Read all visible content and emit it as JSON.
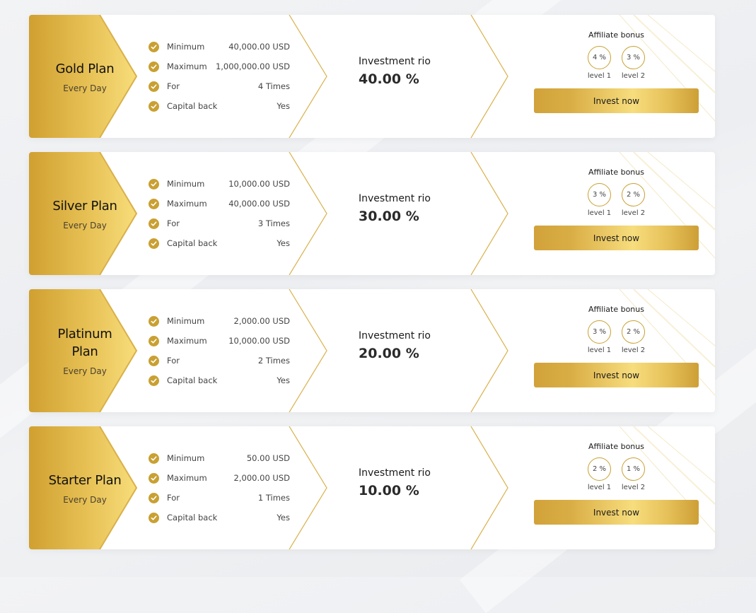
{
  "plans": [
    {
      "name": "Gold Plan",
      "period": "Every Day",
      "features": [
        {
          "label": "Minimum",
          "value": "40,000.00 USD"
        },
        {
          "label": "Maximum",
          "value": "1,000,000.00 USD"
        },
        {
          "label": "For",
          "value": "4 Times"
        },
        {
          "label": "Capital back",
          "value": "Yes"
        }
      ],
      "roi_label": "Investment rio",
      "roi_value": "40.00 %",
      "affiliate_title": "Affiliate bonus",
      "levels": [
        {
          "percent": "4 %",
          "label": "level 1"
        },
        {
          "percent": "3 %",
          "label": "level 2"
        }
      ],
      "button_label": "Invest now"
    },
    {
      "name": "Silver Plan",
      "period": "Every Day",
      "features": [
        {
          "label": "Minimum",
          "value": "10,000.00 USD"
        },
        {
          "label": "Maximum",
          "value": "40,000.00 USD"
        },
        {
          "label": "For",
          "value": "3 Times"
        },
        {
          "label": "Capital back",
          "value": "Yes"
        }
      ],
      "roi_label": "Investment rio",
      "roi_value": "30.00 %",
      "affiliate_title": "Affiliate bonus",
      "levels": [
        {
          "percent": "3 %",
          "label": "level 1"
        },
        {
          "percent": "2 %",
          "label": "level 2"
        }
      ],
      "button_label": "Invest now"
    },
    {
      "name": "Platinum Plan",
      "period": "Every Day",
      "features": [
        {
          "label": "Minimum",
          "value": "2,000.00 USD"
        },
        {
          "label": "Maximum",
          "value": "10,000.00 USD"
        },
        {
          "label": "For",
          "value": "2 Times"
        },
        {
          "label": "Capital back",
          "value": "Yes"
        }
      ],
      "roi_label": "Investment rio",
      "roi_value": "20.00 %",
      "affiliate_title": "Affiliate bonus",
      "levels": [
        {
          "percent": "3 %",
          "label": "level 1"
        },
        {
          "percent": "2 %",
          "label": "level 2"
        }
      ],
      "button_label": "Invest now"
    },
    {
      "name": "Starter Plan",
      "period": "Every Day",
      "features": [
        {
          "label": "Minimum",
          "value": "50.00 USD"
        },
        {
          "label": "Maximum",
          "value": "2,000.00 USD"
        },
        {
          "label": "For",
          "value": "1 Times"
        },
        {
          "label": "Capital back",
          "value": "Yes"
        }
      ],
      "roi_label": "Investment rio",
      "roi_value": "10.00 %",
      "affiliate_title": "Affiliate bonus",
      "levels": [
        {
          "percent": "2 %",
          "label": "level 1"
        },
        {
          "percent": "1 %",
          "label": "level 2"
        }
      ],
      "button_label": "Invest now"
    }
  ],
  "icons": {
    "feature_icon": "check-circle-icon"
  },
  "colors": {
    "gold_dark": "#c9a032",
    "gold_light": "#f7dd7d",
    "card_background": "#ffffff",
    "page_background": "#eef0f2"
  }
}
